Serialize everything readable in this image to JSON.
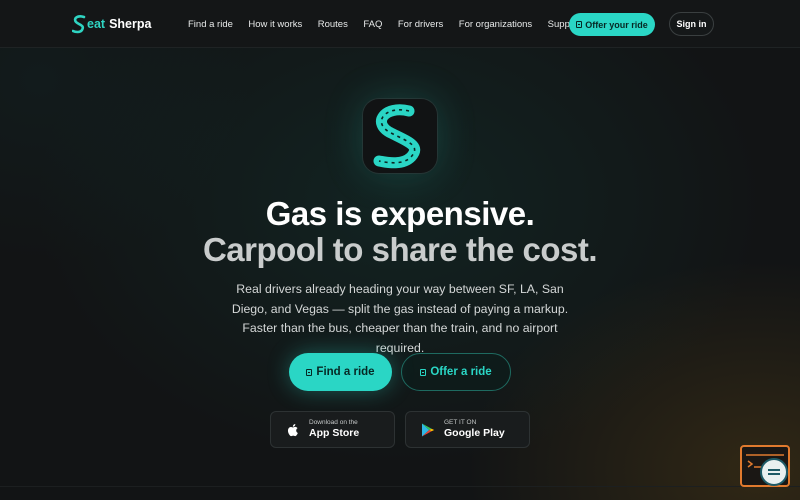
{
  "brand": {
    "name_part1": "eat",
    "name_part2": "Sherpa",
    "accent": "#2ad6c5"
  },
  "nav": {
    "links": [
      "Find a ride",
      "How it works",
      "Routes",
      "FAQ",
      "For drivers",
      "For organizations",
      "Support"
    ],
    "offer_label": "Offer your ride",
    "signin_label": "Sign in"
  },
  "hero": {
    "title_line1": "Gas is expensive.",
    "title_line2": "Carpool to share the cost.",
    "subtitle": "Real drivers already heading your way between SF, LA, San Diego, and Vegas — split the gas instead of paying a markup. Faster than the bus, cheaper than the train, and no airport required.",
    "find_label": "Find a ride",
    "offer_label": "Offer a ride"
  },
  "stores": {
    "apple_small": "Download on the",
    "apple_big": "App Store",
    "google_small": "GET IT ON",
    "google_big": "Google Play"
  },
  "icons": {
    "logo": "road-s-logo-icon",
    "app": "road-s-app-icon",
    "apple": "apple-icon",
    "google_play": "google-play-icon",
    "chat": "chat-widget-icon"
  }
}
